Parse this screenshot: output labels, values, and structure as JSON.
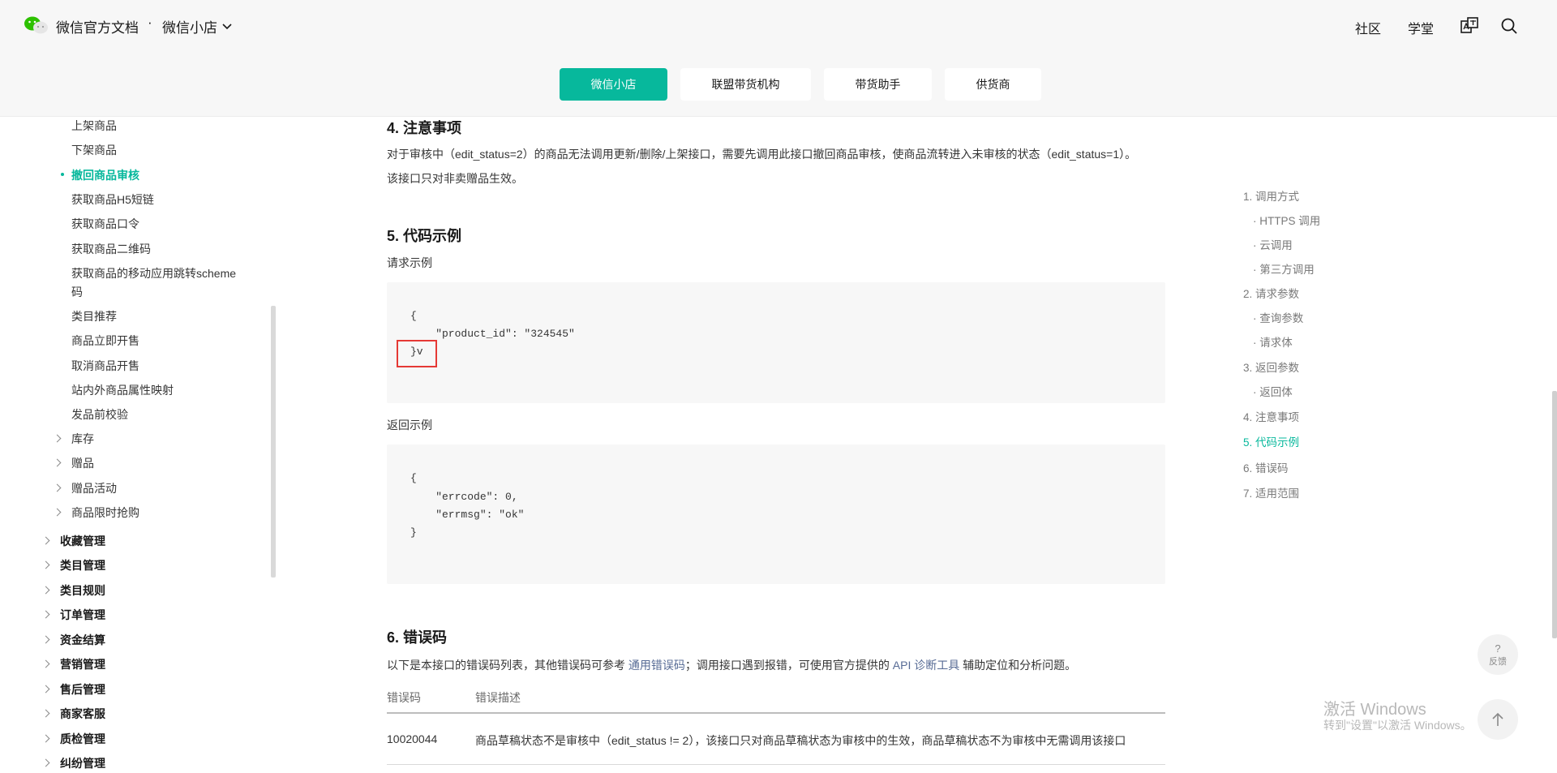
{
  "header": {
    "brand": "微信官方文档",
    "separator": "·",
    "product": "微信小店",
    "nav": [
      "社区",
      "学堂"
    ]
  },
  "tabs": [
    {
      "label": "微信小店",
      "active": true
    },
    {
      "label": "联盟带货机构",
      "active": false
    },
    {
      "label": "带货助手",
      "active": false
    },
    {
      "label": "供货商",
      "active": false
    }
  ],
  "sidebar": {
    "sub_items": [
      "上架商品",
      "下架商品",
      "撤回商品审核",
      "获取商品H5短链",
      "获取商品口令",
      "获取商品二维码",
      "获取商品的移动应用跳转scheme",
      "码",
      "类目推荐",
      "商品立即开售",
      "取消商品开售",
      "站内外商品属性映射",
      "发品前校验"
    ],
    "sub_groups": [
      "库存",
      "赠品",
      "赠品活动",
      "商品限时抢购"
    ],
    "groups": [
      "收藏管理",
      "类目管理",
      "类目规则",
      "订单管理",
      "资金结算",
      "营销管理",
      "售后管理",
      "商家客服",
      "质检管理",
      "纠纷管理"
    ]
  },
  "content": {
    "s4_title": "4. 注意事项",
    "s4_p1": "对于审核中（edit_status=2）的商品无法调用更新/删除/上架接口，需要先调用此接口撤回商品审核，使商品流转进入未审核的状态（edit_status=1）。",
    "s4_p2": "该接口只对非卖赠品生效。",
    "s5_title": "5. 代码示例",
    "req_label": "请求示例",
    "req_code": [
      "{",
      "    \"product_id\": \"324545\"",
      "}v"
    ],
    "resp_label": "返回示例",
    "resp_code": [
      "{",
      "    \"errcode\": 0,",
      "    \"errmsg\": \"ok\"",
      "}"
    ],
    "s6_title": "6. 错误码",
    "s6_p_pre": "以下是本接口的错误码列表，其他错误码可参考 ",
    "s6_link1": "通用错误码",
    "s6_p_mid": "；调用接口遇到报错，可使用官方提供的 ",
    "s6_link2": "API 诊断工具",
    "s6_p_post": " 辅助定位和分析问题。",
    "table_headers": [
      "错误码",
      "错误描述"
    ],
    "table_rows": [
      {
        "code": "10020044",
        "desc": "商品草稿状态不是审核中（edit_status != 2），该接口只对商品草稿状态为审核中的生效，商品草稿状态不为审核中无需调用该接口"
      }
    ]
  },
  "toc": [
    {
      "label": "1. 调用方式",
      "level": 1
    },
    {
      "label": "· HTTPS 调用",
      "level": 2
    },
    {
      "label": "· 云调用",
      "level": 2
    },
    {
      "label": "· 第三方调用",
      "level": 2
    },
    {
      "label": "2. 请求参数",
      "level": 1
    },
    {
      "label": "· 查询参数",
      "level": 2
    },
    {
      "label": "· 请求体",
      "level": 2
    },
    {
      "label": "3. 返回参数",
      "level": 1
    },
    {
      "label": "· 返回体",
      "level": 2
    },
    {
      "label": "4. 注意事项",
      "level": 1
    },
    {
      "label": "5. 代码示例",
      "level": 1,
      "active": true
    },
    {
      "label": "6. 错误码",
      "level": 1
    },
    {
      "label": "7. 适用范围",
      "level": 1
    }
  ],
  "floating": {
    "feedback_label": "反馈",
    "feedback_mark": "?"
  },
  "watermark": {
    "title": "激活 Windows",
    "subtitle": "转到\"设置\"以激活 Windows。"
  },
  "colors": {
    "accent": "#07b89c",
    "link": "#576b95",
    "highlight_border": "#e53935"
  }
}
